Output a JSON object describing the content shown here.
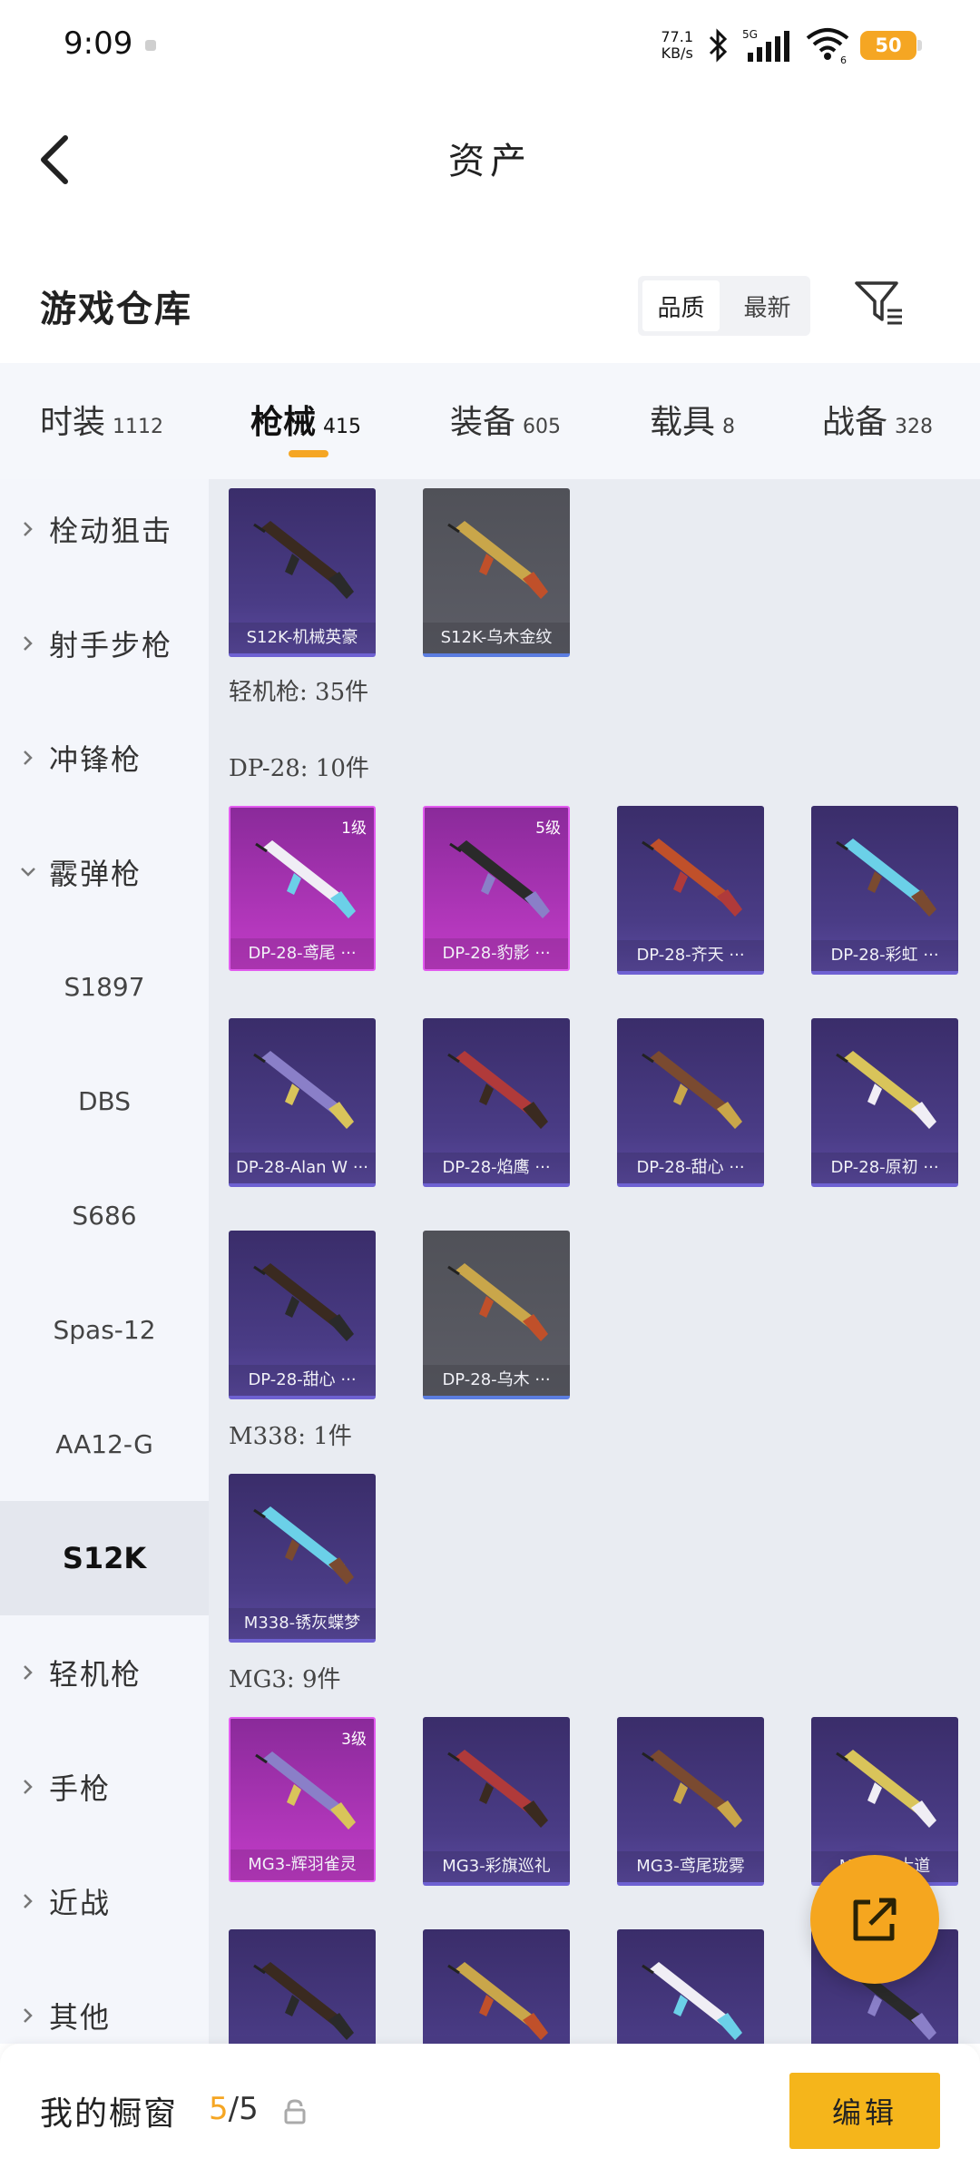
{
  "status_bar": {
    "time": "9:09",
    "net_speed_value": "77.1",
    "net_speed_unit": "KB/s",
    "network_type": "5G",
    "wifi_level": "6",
    "battery": "50"
  },
  "header": {
    "title": "资产"
  },
  "warehouse": {
    "title": "游戏仓库",
    "sort_options": [
      "品质",
      "最新"
    ],
    "active_sort": "品质"
  },
  "tabs": [
    {
      "label": "时装",
      "count": "1112"
    },
    {
      "label": "枪械",
      "count": "415",
      "active": true
    },
    {
      "label": "装备",
      "count": "605"
    },
    {
      "label": "载具",
      "count": "8"
    },
    {
      "label": "战备",
      "count": "328"
    }
  ],
  "sidebar": [
    {
      "label": "栓动狙击",
      "type": "category",
      "expanded": false
    },
    {
      "label": "射手步枪",
      "type": "category",
      "expanded": false
    },
    {
      "label": "冲锋枪",
      "type": "category",
      "expanded": false
    },
    {
      "label": "霰弹枪",
      "type": "category",
      "expanded": true
    },
    {
      "label": "S1897",
      "type": "sub"
    },
    {
      "label": "DBS",
      "type": "sub"
    },
    {
      "label": "S686",
      "type": "sub"
    },
    {
      "label": "Spas-12",
      "type": "sub"
    },
    {
      "label": "AA12-G",
      "type": "sub"
    },
    {
      "label": "S12K",
      "type": "sub",
      "selected": true
    },
    {
      "label": "轻机枪",
      "type": "category",
      "expanded": false
    },
    {
      "label": "手枪",
      "type": "category",
      "expanded": false
    },
    {
      "label": "近战",
      "type": "category",
      "expanded": false
    },
    {
      "label": "其他",
      "type": "category",
      "expanded": false
    }
  ],
  "content": {
    "s12k_items": [
      {
        "name": "S12K-机械英豪",
        "rarity": "purple"
      },
      {
        "name": "S12K-乌木金纹",
        "rarity": "gray"
      }
    ],
    "lmg_label": "轻机枪: 35件",
    "dp28_label": "DP-28: 10件",
    "dp28_items": [
      {
        "name": "DP-28-鸢尾 ···",
        "rarity": "pink",
        "level": "1级"
      },
      {
        "name": "DP-28-豹影 ···",
        "rarity": "pink",
        "level": "5级"
      },
      {
        "name": "DP-28-齐天 ···",
        "rarity": "purple"
      },
      {
        "name": "DP-28-彩虹 ···",
        "rarity": "purple"
      },
      {
        "name": "DP-28-Alan W ···",
        "rarity": "purple"
      },
      {
        "name": "DP-28-焰鹰 ···",
        "rarity": "purple"
      },
      {
        "name": "DP-28-甜心 ···",
        "rarity": "purple"
      },
      {
        "name": "DP-28-原初 ···",
        "rarity": "purple"
      },
      {
        "name": "DP-28-甜心 ···",
        "rarity": "purple"
      },
      {
        "name": "DP-28-乌木 ···",
        "rarity": "gray"
      }
    ],
    "m338_label": "M338: 1件",
    "m338_items": [
      {
        "name": "M338-锈灰蝶梦",
        "rarity": "purple"
      }
    ],
    "mg3_label": "MG3: 9件",
    "mg3_items": [
      {
        "name": "MG3-辉羽雀灵",
        "rarity": "pink",
        "level": "3级"
      },
      {
        "name": "MG3-彩旗巡礼",
        "rarity": "purple"
      },
      {
        "name": "MG3-鸢尾珑雾",
        "rarity": "purple"
      },
      {
        "name": "MG3-···大道",
        "rarity": "purple"
      },
      {
        "name": "",
        "rarity": "purple"
      },
      {
        "name": "",
        "rarity": "purple"
      },
      {
        "name": "",
        "rarity": "purple"
      },
      {
        "name": "",
        "rarity": "purple"
      }
    ]
  },
  "bottom_bar": {
    "label": "我的橱窗",
    "current": "5",
    "total": "/5",
    "edit_label": "编辑"
  },
  "colors": {
    "accent": "#f5a623",
    "rarity_purple": "#4a3c86",
    "rarity_pink": "#c23cc8",
    "rarity_gray": "#5c5d66"
  },
  "icons": [
    "back-arrow-icon",
    "filter-icon",
    "chevron-right-icon",
    "chevron-down-icon",
    "share-icon",
    "lock-icon",
    "bluetooth-icon",
    "signal-icon",
    "wifi-icon",
    "battery-icon"
  ]
}
